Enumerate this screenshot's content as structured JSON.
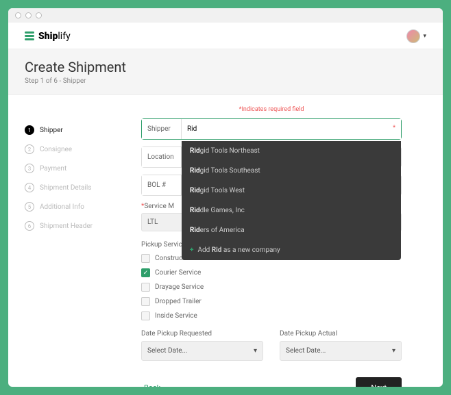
{
  "brand": {
    "prefix": "Ship",
    "suffix": "lify"
  },
  "header": {
    "title": "Create Shipment",
    "step_line": "Step 1 of 6 - Shipper"
  },
  "required_note": "*Indicates required field",
  "sidebar": {
    "items": [
      {
        "num": "1",
        "label": "Shipper",
        "active": true
      },
      {
        "num": "2",
        "label": "Consignee",
        "active": false
      },
      {
        "num": "3",
        "label": "Payment",
        "active": false
      },
      {
        "num": "4",
        "label": "Shipment Details",
        "active": false
      },
      {
        "num": "5",
        "label": "Additional Info",
        "active": false
      },
      {
        "num": "6",
        "label": "Shipment Header",
        "active": false
      }
    ]
  },
  "fields": {
    "shipper_label": "Shipper",
    "shipper_value": "Rid",
    "location_label": "Location",
    "bol_label": "BOL #"
  },
  "dropdown": {
    "prefix": "Rid",
    "items": [
      {
        "rest": "gid Tools Northeast"
      },
      {
        "rest": "gid Tools Southeast"
      },
      {
        "rest": "gid Tools West"
      },
      {
        "rest": "dle Games, Inc"
      },
      {
        "rest": "ers of America"
      }
    ],
    "add_prefix": "Add ",
    "add_bold": "Rid",
    "add_suffix": " as a new company"
  },
  "service_mode": {
    "label": "*Service M",
    "value": "LTL"
  },
  "pickup": {
    "label": "Pickup Services",
    "items": [
      {
        "label": "Construction Site",
        "checked": false
      },
      {
        "label": "Courier Service",
        "checked": true
      },
      {
        "label": "Drayage Service",
        "checked": false
      },
      {
        "label": "Dropped Trailer",
        "checked": false
      },
      {
        "label": "Inside Service",
        "checked": false
      }
    ]
  },
  "dates": {
    "requested_label": "Date Pickup Requested",
    "actual_label": "Date Pickup Actual",
    "placeholder": "Select Date..."
  },
  "buttons": {
    "back": "Back",
    "next": "Next"
  }
}
